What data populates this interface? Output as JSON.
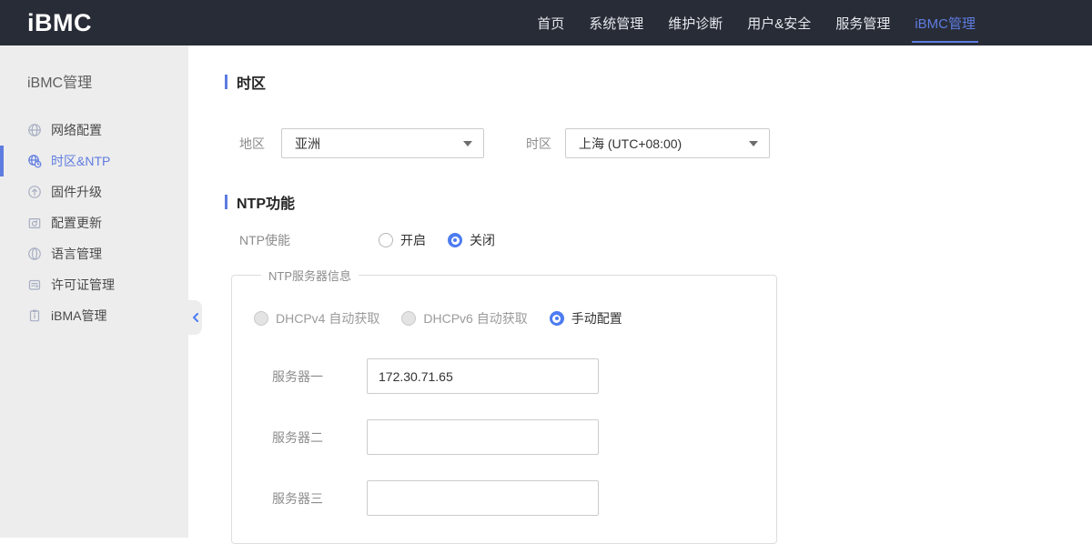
{
  "navbar": {
    "logo": "iBMC",
    "items": [
      {
        "label": "首页",
        "active": false
      },
      {
        "label": "系统管理",
        "active": false
      },
      {
        "label": "维护诊断",
        "active": false
      },
      {
        "label": "用户&安全",
        "active": false
      },
      {
        "label": "服务管理",
        "active": false
      },
      {
        "label": "iBMC管理",
        "active": true
      }
    ]
  },
  "sidebar": {
    "title": "iBMC管理",
    "items": [
      {
        "label": "网络配置",
        "icon": "network-globe-icon",
        "active": false
      },
      {
        "label": "时区&NTP",
        "icon": "timezone-clock-icon",
        "active": true
      },
      {
        "label": "固件升级",
        "icon": "firmware-upgrade-icon",
        "active": false
      },
      {
        "label": "配置更新",
        "icon": "config-update-icon",
        "active": false
      },
      {
        "label": "语言管理",
        "icon": "language-globe-icon",
        "active": false
      },
      {
        "label": "许可证管理",
        "icon": "license-icon",
        "active": false
      },
      {
        "label": "iBMA管理",
        "icon": "ibma-clipboard-icon",
        "active": false
      }
    ],
    "collapse_icon": "chevron-left"
  },
  "main": {
    "timezone_section": {
      "title": "时区",
      "region_label": "地区",
      "region_value": "亚洲",
      "timezone_label": "时区",
      "timezone_value": "上海 (UTC+08:00)"
    },
    "ntp_section": {
      "title": "NTP功能",
      "enable_label": "NTP使能",
      "enable_options": [
        {
          "label": "开启",
          "selected": false
        },
        {
          "label": "关闭",
          "selected": true
        }
      ],
      "server_group": {
        "legend": "NTP服务器信息",
        "mode_options": [
          {
            "label": "DHCPv4 自动获取",
            "selected": false,
            "disabled": true
          },
          {
            "label": "DHCPv6 自动获取",
            "selected": false,
            "disabled": true
          },
          {
            "label": "手动配置",
            "selected": true,
            "disabled": false
          }
        ],
        "servers": [
          {
            "label": "服务器一",
            "value": "172.30.71.65"
          },
          {
            "label": "服务器二",
            "value": ""
          },
          {
            "label": "服务器三",
            "value": ""
          }
        ]
      }
    }
  },
  "colors": {
    "accent": "#5e7ce0",
    "radio_blue": "#4d7cf0",
    "navbar_bg": "#282c36",
    "sidebar_bg": "#ededed"
  }
}
